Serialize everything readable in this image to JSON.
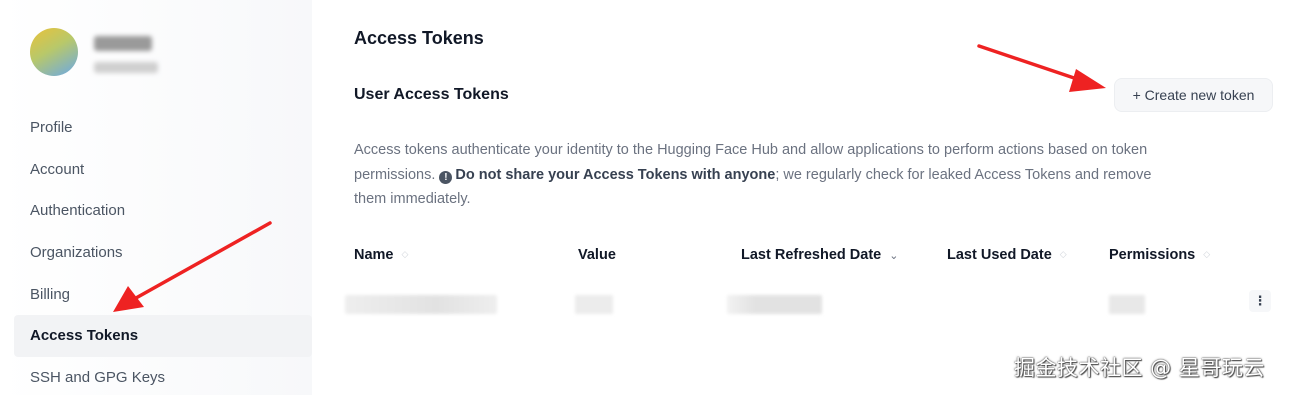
{
  "sidebar": {
    "nav_items": [
      {
        "label": "Profile"
      },
      {
        "label": "Account"
      },
      {
        "label": "Authentication"
      },
      {
        "label": "Organizations"
      },
      {
        "label": "Billing"
      },
      {
        "label": "Access Tokens",
        "active": true
      },
      {
        "label": "SSH and GPG Keys"
      }
    ]
  },
  "main": {
    "page_title": "Access Tokens",
    "section_title": "User Access Tokens",
    "create_button_label": "+ Create new token",
    "description": {
      "part1": "Access tokens authenticate your identity to the Hugging Face Hub and allow applications to perform actions based on token permissions.",
      "warning": "Do not share your Access Tokens with anyone",
      "part2": "; we regularly check for leaked Access Tokens and remove them immediately."
    },
    "table": {
      "columns": [
        "Name",
        "Value",
        "Last Refreshed Date",
        "Last Used Date",
        "Permissions"
      ]
    }
  },
  "watermark": "掘金技术社区 @ 星哥玩云",
  "colors": {
    "arrow": "#ee2222",
    "active_nav_bg": "#f2f3f5"
  },
  "icons": [
    "info-icon",
    "sort-icon",
    "sort-desc-icon",
    "kebab-menu-icon",
    "avatar"
  ]
}
